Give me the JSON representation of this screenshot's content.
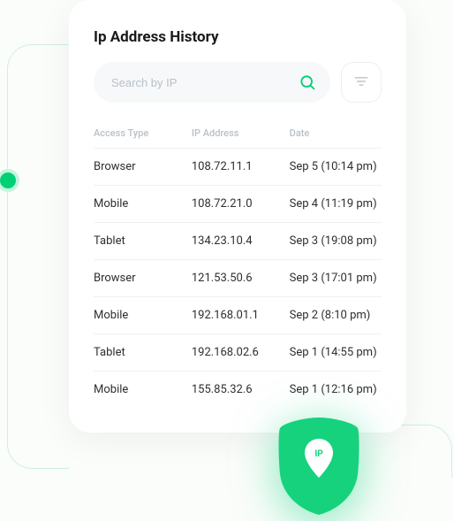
{
  "title": "Ip Address History",
  "search": {
    "placeholder": "Search by IP"
  },
  "columns": [
    "Access Type",
    "IP Address",
    "Date"
  ],
  "rows": [
    {
      "type": "Browser",
      "ip": "108.72.11.1",
      "date": "Sep 5 (10:14 pm)"
    },
    {
      "type": "Mobile",
      "ip": "108.72.21.0",
      "date": "Sep 4 (11:19 pm)"
    },
    {
      "type": "Tablet",
      "ip": "134.23.10.4",
      "date": "Sep 3 (19:08 pm)"
    },
    {
      "type": "Browser",
      "ip": "121.53.50.6",
      "date": "Sep 3 (17:01 pm)"
    },
    {
      "type": "Mobile",
      "ip": "192.168.01.1",
      "date": "Sep 2 (8:10 pm)"
    },
    {
      "type": "Tablet",
      "ip": "192.168.02.6",
      "date": "Sep 1 (14:55 pm)"
    },
    {
      "type": "Mobile",
      "ip": "155.85.32.6",
      "date": "Sep 1 (12:16 pm)"
    }
  ],
  "badge": {
    "label": "IP"
  },
  "colors": {
    "accent": "#00d176"
  }
}
